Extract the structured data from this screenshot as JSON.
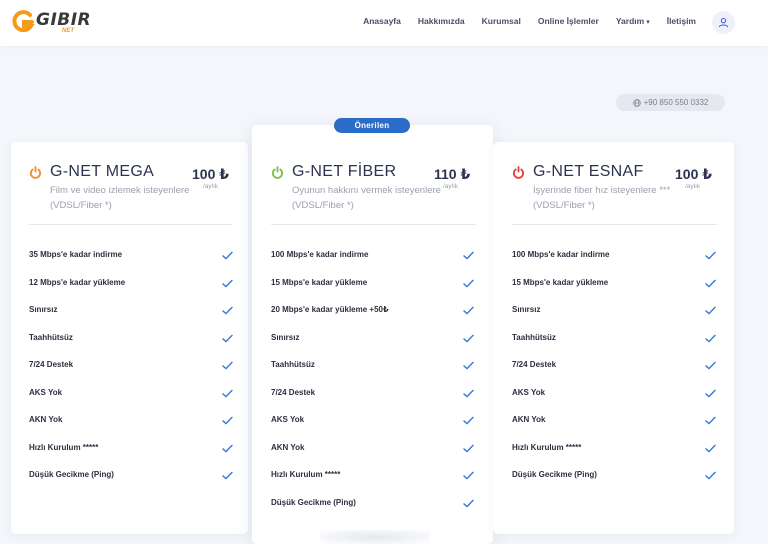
{
  "brand": {
    "name": "GIBIR",
    "sub": "NET"
  },
  "nav": {
    "items": [
      {
        "label": "Anasayfa"
      },
      {
        "label": "Hakkımızda"
      },
      {
        "label": "Kurumsal"
      },
      {
        "label": "Online İşlemler"
      },
      {
        "label": "Yardım",
        "has_dropdown": true
      },
      {
        "label": "İletişim"
      }
    ]
  },
  "contact": {
    "phone": "+90 850 550 0332"
  },
  "badge": {
    "label": "Önerilen"
  },
  "colors": {
    "accent": "#2a6cc7",
    "check": "#3a7bd5",
    "mega_icon": "#f2902a",
    "fiber_icon": "#7cc24a",
    "esnaf_icon": "#e8413c"
  },
  "plans": [
    {
      "name": "G-NET MEGA",
      "desc1": "Film ve video izlemek isteyenlere",
      "desc2": "(VDSL/Fiber *)",
      "price": "100 ₺",
      "per": "/aylık",
      "icon": "power-icon",
      "features": [
        "35 Mbps'e kadar indirme",
        "12 Mbps'e kadar yükleme",
        "Sınırsız",
        "Taahhütsüz",
        "7/24 Destek",
        "AKS Yok",
        "AKN Yok",
        "Hızlı Kurulum *****",
        "Düşük Gecikme (Ping)"
      ]
    },
    {
      "name": "G-NET FİBER",
      "desc1": "Oyunun hakkını vermek isteyenlere",
      "desc2": "(VDSL/Fiber *)",
      "price": "110 ₺",
      "per": "/aylık",
      "icon": "power-icon",
      "features": [
        "100 Mbps'e kadar indirme",
        "15 Mbps'e kadar yükleme",
        "20 Mbps'e kadar yükleme +50₺",
        "Sınırsız",
        "Taahhütsüz",
        "7/24 Destek",
        "AKS Yok",
        "AKN Yok",
        "Hızlı Kurulum *****",
        "Düşük Gecikme (Ping)"
      ]
    },
    {
      "name": "G-NET ESNAF",
      "desc1": "İşyerinde fiber hız isteyenlere ***",
      "desc2": "(VDSL/Fiber *)",
      "price": "100 ₺",
      "per": "/aylık",
      "icon": "power-icon",
      "features": [
        "100 Mbps'e kadar indirme",
        "15 Mbps'e kadar yükleme",
        "Sınırsız",
        "Taahhütsüz",
        "7/24 Destek",
        "AKS Yok",
        "AKN Yok",
        "Hızlı Kurulum *****",
        "Düşük Gecikme (Ping)"
      ]
    }
  ]
}
